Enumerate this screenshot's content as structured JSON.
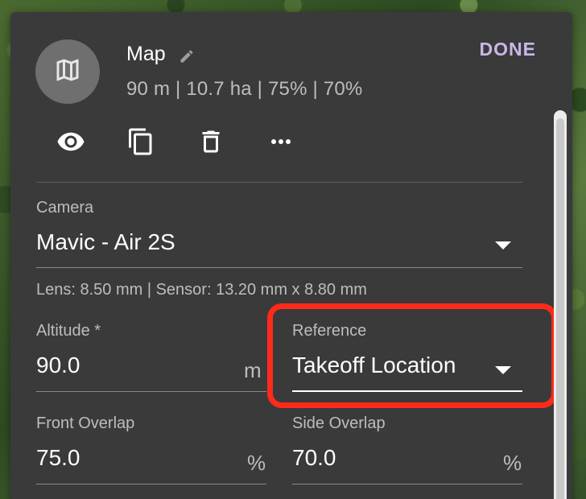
{
  "header": {
    "title": "Map",
    "subtitle": "90 m | 10.7 ha | 75% | 70%",
    "done_label": "DONE",
    "avatar_icon": "map-icon",
    "edit_icon": "pencil-icon"
  },
  "toolbar": {
    "items": [
      {
        "icon": "eye-icon"
      },
      {
        "icon": "copy-icon"
      },
      {
        "icon": "trash-icon"
      },
      {
        "icon": "more-icon"
      }
    ]
  },
  "camera": {
    "label": "Camera",
    "value": "Mavic - Air 2S",
    "helper": "Lens: 8.50 mm | Sensor: 13.20 mm x 8.80 mm"
  },
  "altitude": {
    "label": "Altitude *",
    "value": "90.0",
    "unit": "m"
  },
  "reference": {
    "label": "Reference",
    "value": "Takeoff Location"
  },
  "front_overlap": {
    "label": "Front Overlap",
    "value": "75.0",
    "unit": "%"
  },
  "side_overlap": {
    "label": "Side Overlap",
    "value": "70.0",
    "unit": "%"
  },
  "colors": {
    "panel": "#3a3a3a",
    "accent": "#c8b8e8",
    "highlight": "#ff2a1a"
  }
}
